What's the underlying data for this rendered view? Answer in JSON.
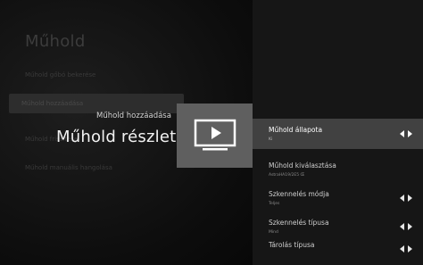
{
  "background_menu": {
    "title": "Műhold",
    "items": [
      "Műhold gőbó bekerése",
      "Műhold hozzáadása",
      "Műhold frissítése",
      "Műhold manuális hangolása"
    ]
  },
  "overlay": {
    "caption": "Műhold hozzáadása",
    "title": "Műhold részlet",
    "tile_icon": "tv-play-icon"
  },
  "settings": [
    {
      "label": "Műhold állapota",
      "value": "Ki",
      "arrows": true,
      "selected": true
    },
    {
      "label": "Műhold kiválasztása",
      "value": "AstraHA19/2E5 Œ",
      "arrows": false,
      "selected": false
    },
    {
      "label": "Szkennelés módja",
      "value": "Teljes",
      "arrows": true,
      "selected": false
    },
    {
      "label": "Szkennelés típusa",
      "value": "Mind",
      "arrows": true,
      "selected": false
    },
    {
      "label": "Tárolás típusa",
      "value": "",
      "arrows": true,
      "selected": false
    }
  ],
  "colors": {
    "panel": "#161616",
    "selected_row": "#414141",
    "tile": "#5f5f5f"
  }
}
